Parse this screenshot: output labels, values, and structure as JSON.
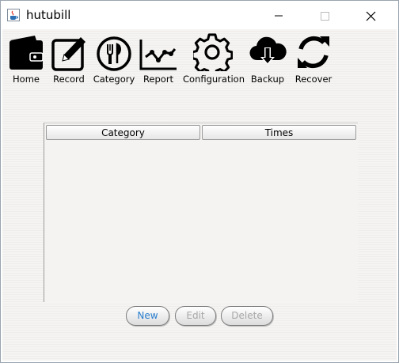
{
  "window": {
    "title": "hutubill",
    "icon": "java-cup-icon"
  },
  "toolbar": {
    "items": [
      {
        "label": "Home",
        "icon": "wallet-icon"
      },
      {
        "label": "Record",
        "icon": "edit-icon"
      },
      {
        "label": "Category",
        "icon": "plate-cutlery-icon"
      },
      {
        "label": "Report",
        "icon": "chart-icon"
      },
      {
        "label": "Configuration",
        "icon": "gear-icon"
      },
      {
        "label": "Backup",
        "icon": "cloud-download-icon"
      },
      {
        "label": "Recover",
        "icon": "refresh-icon"
      }
    ]
  },
  "table": {
    "columns": [
      "Category",
      "Times"
    ],
    "rows": []
  },
  "actions": {
    "new_label": "New",
    "edit_label": "Edit",
    "delete_label": "Delete"
  },
  "colors": {
    "active_button_text": "#2a7fd0",
    "disabled_button_text": "#a7a7a7"
  }
}
